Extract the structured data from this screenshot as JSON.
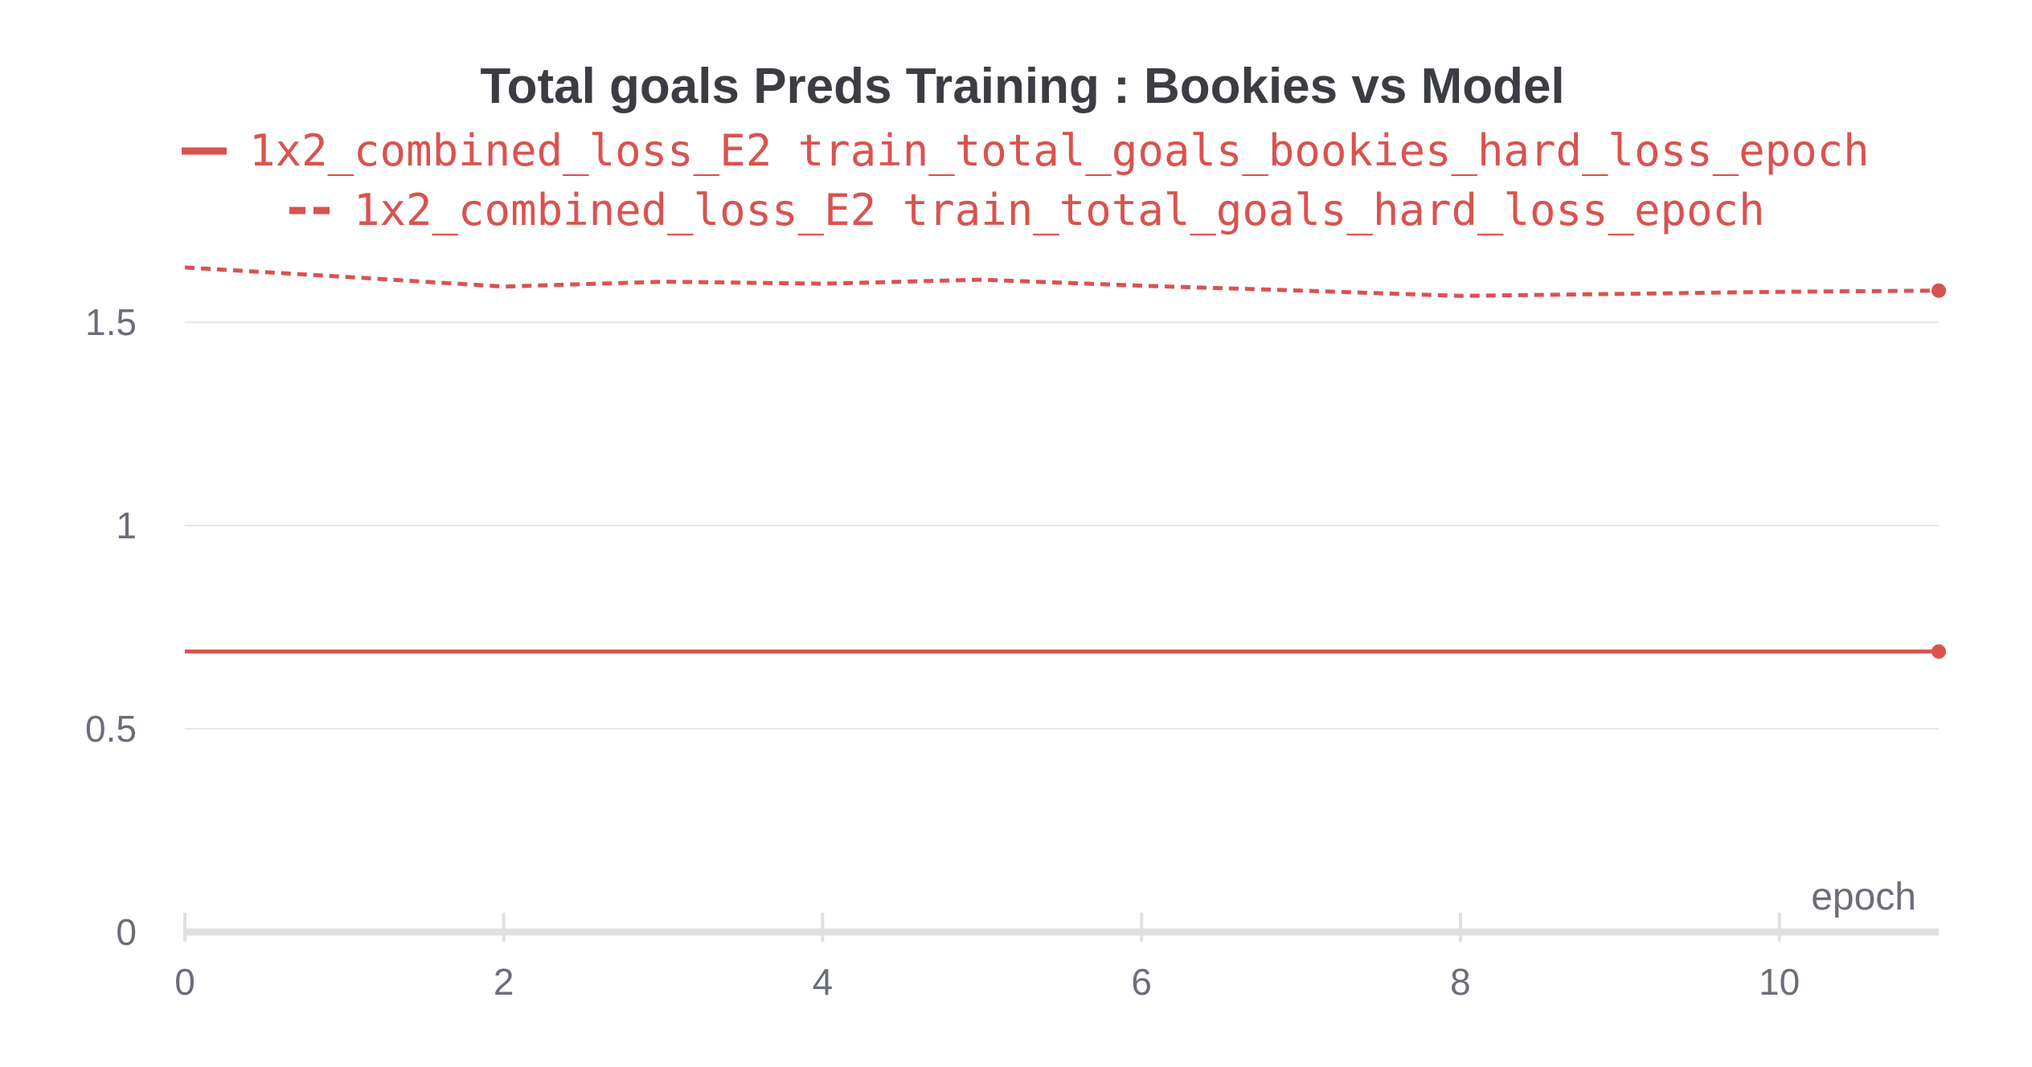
{
  "chart_data": {
    "type": "line",
    "title": "Total goals Preds Training : Bookies vs Model",
    "xlabel": "epoch",
    "ylabel": "",
    "xlim": [
      0,
      11
    ],
    "ylim": [
      0,
      1.7
    ],
    "x_ticks": [
      "0",
      "2",
      "4",
      "6",
      "8",
      "10"
    ],
    "y_ticks": [
      "0",
      "0.5",
      "1",
      "1.5"
    ],
    "grid": true,
    "legend_position": "top",
    "series": [
      {
        "name": "1x2_combined_loss_E2 train_total_goals_bookies_hard_loss_epoch",
        "style": "solid",
        "color": "#d9534f",
        "x": [
          0,
          1,
          2,
          3,
          4,
          5,
          6,
          7,
          8,
          9,
          10,
          11
        ],
        "values": [
          0.69,
          0.69,
          0.69,
          0.69,
          0.69,
          0.69,
          0.69,
          0.69,
          0.69,
          0.69,
          0.69,
          0.69
        ]
      },
      {
        "name": "1x2_combined_loss_E2 train_total_goals_hard_loss_epoch",
        "style": "dashed",
        "color": "#d9534f",
        "x": [
          0,
          1,
          2,
          3,
          4,
          5,
          6,
          7,
          8,
          9,
          10,
          11
        ],
        "values": [
          1.635,
          1.612,
          1.588,
          1.6,
          1.595,
          1.605,
          1.59,
          1.578,
          1.565,
          1.57,
          1.575,
          1.578
        ]
      }
    ]
  }
}
